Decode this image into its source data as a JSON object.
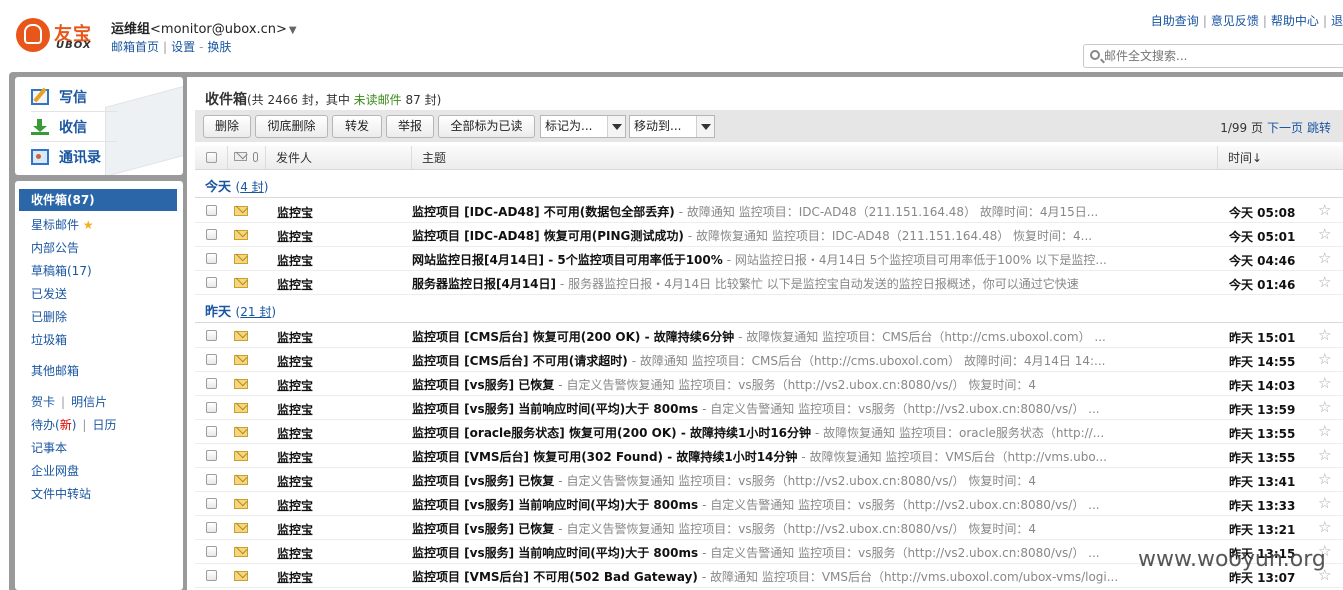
{
  "brand": {
    "logo_cn": "友宝",
    "logo_en": "UBOX"
  },
  "account": {
    "name": "运维组",
    "email": "<monitor@ubox.cn>",
    "links": [
      "邮箱首页",
      "设置",
      "换肤"
    ]
  },
  "top_links": [
    "自助查询",
    "意见反馈",
    "帮助中心",
    "退"
  ],
  "search": {
    "placeholder": "邮件全文搜索..."
  },
  "compose_menu": [
    {
      "label": "写信",
      "icon": "compose-icon"
    },
    {
      "label": "收信",
      "icon": "receive-icon"
    },
    {
      "label": "通讯录",
      "icon": "address-book-icon"
    }
  ],
  "folders": {
    "inbox": "收件箱(87)",
    "starred": "星标邮件",
    "announce": "内部公告",
    "drafts": "草稿箱(17)",
    "sent": "已发送",
    "deleted": "已删除",
    "spam": "垃圾箱",
    "other": "其他邮箱",
    "card": "贺卡",
    "postcard": "明信片",
    "todo": "待办(",
    "todo_new": "新",
    "todo_end": ")",
    "calendar": "日历",
    "notes": "记事本",
    "disk": "企业网盘",
    "transfer": "文件中转站"
  },
  "inbox_header": {
    "title": "收件箱",
    "part1": "(共 2466 封，其中 ",
    "unread": "未读邮件",
    "part2": " 87 封)"
  },
  "toolbar": {
    "delete": "删除",
    "purge": "彻底删除",
    "forward": "转发",
    "report": "举报",
    "mark_all_read": "全部标为已读",
    "mark_as": "标记为...",
    "move_to": "移动到...",
    "page_info": "1/99 页",
    "next_page": "下一页",
    "jump": "跳转"
  },
  "columns": {
    "sender": "发件人",
    "subject": "主题",
    "time": "时间↓"
  },
  "groups": [
    {
      "label": "今天",
      "count": "4 封",
      "rows": [
        {
          "sender": "监控宝",
          "subject": "监控项目 [IDC-AD48] 不可用(数据包全部丢弃)",
          "preview": "-        故障通知    监控项目：IDC-AD48（211.151.164.48）  故障时间：4月15日...",
          "time": "今天 05:08"
        },
        {
          "sender": "监控宝",
          "subject": "监控项目 [IDC-AD48] 恢复可用(PING测试成功)",
          "preview": "-        故障恢复通知    监控项目：IDC-AD48（211.151.164.48）  恢复时间：4...",
          "time": "今天 05:01"
        },
        {
          "sender": "监控宝",
          "subject": "网站监控日报[4月14日] - 5个监控项目可用率低于100%",
          "preview": "-        网站监控日报・4月14日 5个监控项目可用率低于100%   以下是监控...",
          "time": "今天 04:46"
        },
        {
          "sender": "监控宝",
          "subject": "服务器监控日报[4月14日]",
          "preview": "-        服务器监控日报・4月14日 比较繁忙   以下是监控宝自动发送的监控日报概述，你可以通过它快速",
          "time": "今天 01:46"
        }
      ]
    },
    {
      "label": "昨天",
      "count": "21 封",
      "rows": [
        {
          "sender": "监控宝",
          "subject": "监控项目 [CMS后台] 恢复可用(200 OK) - 故障持续6分钟",
          "preview": "-        故障恢复通知    监控项目：CMS后台（http://cms.uboxol.com）  ...",
          "time": "昨天 15:01"
        },
        {
          "sender": "监控宝",
          "subject": "监控项目 [CMS后台] 不可用(请求超时)",
          "preview": "-        故障通知    监控项目：CMS后台（http://cms.uboxol.com）  故障时间：4月14日 14:...",
          "time": "昨天 14:55"
        },
        {
          "sender": "监控宝",
          "subject": "监控项目 [vs服务] 已恢复",
          "preview": "-        自定义告警恢复通知    监控项目：vs服务（http://vs2.ubox.cn:8080/vs/）  恢复时间：4",
          "time": "昨天 14:03"
        },
        {
          "sender": "监控宝",
          "subject": "监控项目 [vs服务] 当前响应时间(平均)大于 800ms",
          "preview": "-        自定义告警通知    监控项目：vs服务（http://vs2.ubox.cn:8080/vs/）  ...",
          "time": "昨天 13:59"
        },
        {
          "sender": "监控宝",
          "subject": "监控项目 [oracle服务状态] 恢复可用(200 OK) - 故障持续1小时16分钟",
          "preview": "-        故障恢复通知    监控项目：oracle服务状态（http://...",
          "time": "昨天 13:55"
        },
        {
          "sender": "监控宝",
          "subject": "监控项目 [VMS后台] 恢复可用(302 Found) - 故障持续1小时14分钟",
          "preview": "-        故障恢复通知    监控项目：VMS后台（http://vms.ubo...",
          "time": "昨天 13:55"
        },
        {
          "sender": "监控宝",
          "subject": "监控项目 [vs服务] 已恢复",
          "preview": "-        自定义告警恢复通知    监控项目：vs服务（http://vs2.ubox.cn:8080/vs/）  恢复时间：4",
          "time": "昨天 13:41"
        },
        {
          "sender": "监控宝",
          "subject": "监控项目 [vs服务] 当前响应时间(平均)大于 800ms",
          "preview": "-        自定义告警通知    监控项目：vs服务（http://vs2.ubox.cn:8080/vs/）  ...",
          "time": "昨天 13:33"
        },
        {
          "sender": "监控宝",
          "subject": "监控项目 [vs服务] 已恢复",
          "preview": "-        自定义告警恢复通知    监控项目：vs服务（http://vs2.ubox.cn:8080/vs/）  恢复时间：4",
          "time": "昨天 13:21"
        },
        {
          "sender": "监控宝",
          "subject": "监控项目 [vs服务] 当前响应时间(平均)大于 800ms",
          "preview": "-        自定义告警通知    监控项目：vs服务（http://vs2.ubox.cn:8080/vs/）  ...",
          "time": "昨天 13:15"
        },
        {
          "sender": "监控宝",
          "subject": "监控项目 [VMS后台] 不可用(502 Bad Gateway)",
          "preview": "-        故障通知    监控项目：VMS后台（http://vms.uboxol.com/ubox-vms/logi...",
          "time": "昨天 13:07"
        }
      ]
    }
  ],
  "watermark": "www.wooyun.org"
}
